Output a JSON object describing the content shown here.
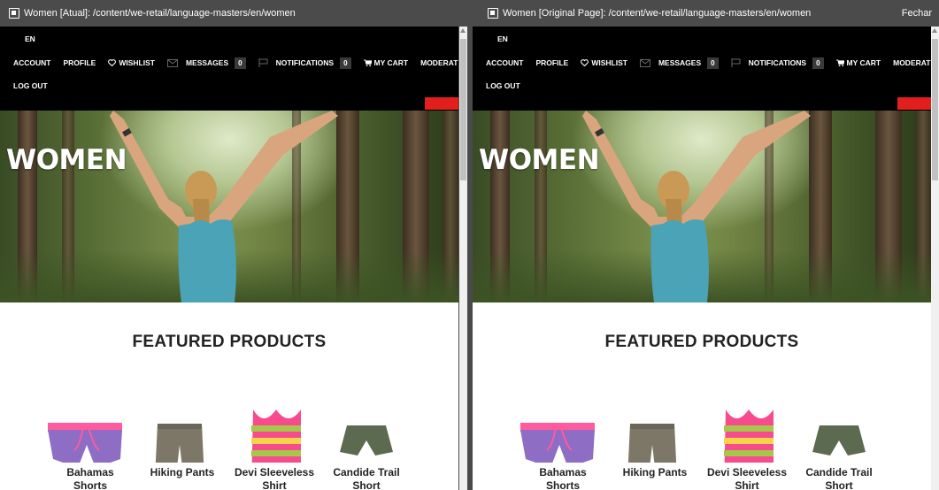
{
  "header": {
    "left_title": "Women [Atual]: /content/we-retail/language-masters/en/women",
    "right_title": "Women [Original Page]: /content/we-retail/language-masters/en/women",
    "close_label": "Fechar"
  },
  "nav": {
    "lang": "EN",
    "account": "ACCOUNT",
    "profile": "PROFILE",
    "wishlist": "WISHLIST",
    "messages": "MESSAGES",
    "messages_count": "0",
    "notifications": "NOTIFICATIONS",
    "notifications_count": "0",
    "cart": "MY CART",
    "moderation": "MODERATION",
    "logout": "LOG OUT"
  },
  "hero": {
    "title": "WOMEN"
  },
  "featured": {
    "title": "FEATURED PRODUCTS",
    "products": [
      {
        "line1": "Bahamas",
        "line2": "Shorts"
      },
      {
        "line1": "Hiking Pants",
        "line2": ""
      },
      {
        "line1": "Devi Sleeveless",
        "line2": "Shirt"
      },
      {
        "line1": "Candide Trail",
        "line2": "Short"
      }
    ]
  },
  "colors": {
    "accent_red": "#e1201e",
    "nav_bg": "#000000",
    "topbar_bg": "#4b4b4b"
  }
}
